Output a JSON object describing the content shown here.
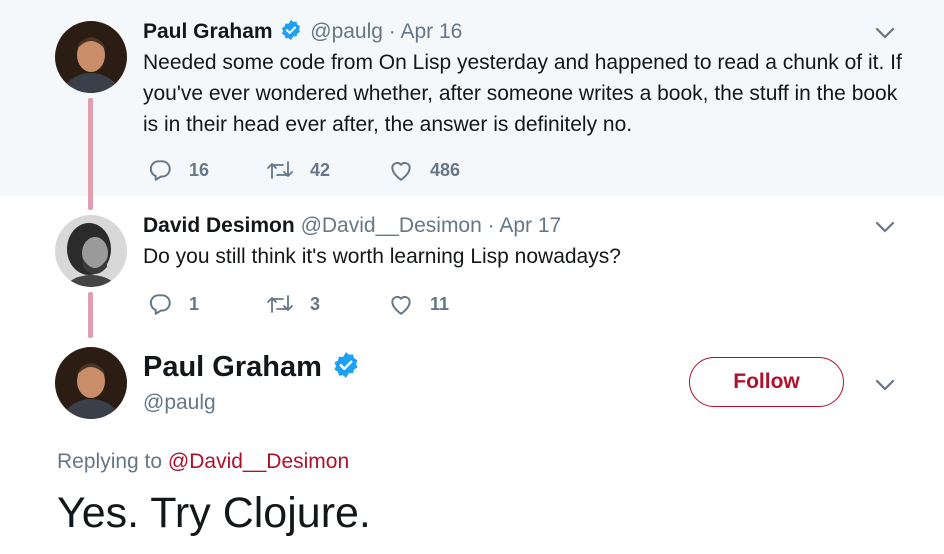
{
  "colors": {
    "accent": "#b1102b",
    "verified": "#1da1f2",
    "muted": "#657786",
    "thread_line": "#e09fae"
  },
  "tweets": [
    {
      "name": "Paul Graham",
      "handle": "@paulg",
      "dot": "·",
      "date": "Apr 16",
      "verified": true,
      "text": "Needed some code from On Lisp yesterday and happened to read a chunk of it. If you've ever wondered whether, after someone writes a book, the stuff in the book is in their head ever after, the answer is definitely no.",
      "replies": "16",
      "retweets": "42",
      "likes": "486"
    },
    {
      "name": "David Desimon",
      "handle": "@David__Desimon",
      "dot": "·",
      "date": "Apr 17",
      "verified": false,
      "text": "Do you still think it's worth learning Lisp nowadays?",
      "replies": "1",
      "retweets": "3",
      "likes": "11"
    }
  ],
  "main_tweet": {
    "name": "Paul Graham",
    "handle": "@paulg",
    "follow_label": "Follow",
    "replying_prefix": "Replying to",
    "replying_to": "@David__Desimon",
    "text": "Yes. Try Clojure."
  },
  "icons": [
    "reply-icon",
    "retweet-icon",
    "like-icon",
    "caret-down-icon",
    "verified-icon"
  ]
}
